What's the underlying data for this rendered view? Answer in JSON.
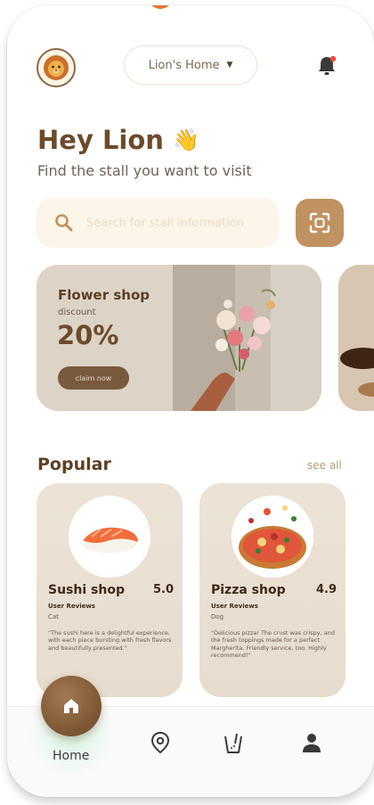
{
  "header": {
    "location_label": "Lion's Home",
    "location_caret": "▼",
    "avatar_icon": "lion-avatar-icon",
    "notification_icon": "bell-icon",
    "has_notification": true
  },
  "greeting": {
    "title": "Hey Lion",
    "emoji": "👋",
    "subtitle": "Find the stall you want to visit"
  },
  "search": {
    "placeholder": "Search for stall information",
    "icon": "search-icon",
    "scan_icon": "scan-icon"
  },
  "promo": {
    "title": "Flower shop",
    "subtitle": "discount",
    "value": "20%",
    "button_label": "claim now"
  },
  "popular": {
    "title": "Popular",
    "see_all": "see all",
    "shops": [
      {
        "name": "Sushi shop",
        "rating": "5.0",
        "reviews_label": "User Reviews",
        "user": "Cat",
        "review": "\"The sushi here is a delightful experience, with each piece bursting with fresh flavors and beautifully presented.\""
      },
      {
        "name": "Pizza shop",
        "rating": "4.9",
        "reviews_label": "User Reviews",
        "user": "Dog",
        "review": "\"Delicious pizza! The crust was crispy, and the fresh toppings made for a perfect Margherita. Friendly service, too. Highly recommend!\""
      }
    ]
  },
  "tabbar": {
    "home_label": "Home",
    "items": [
      "home-icon",
      "location-icon",
      "drink-icon",
      "profile-icon"
    ]
  },
  "colors": {
    "brand": "#7b5533",
    "accent": "#c09262",
    "notification": "#e74c3c"
  }
}
